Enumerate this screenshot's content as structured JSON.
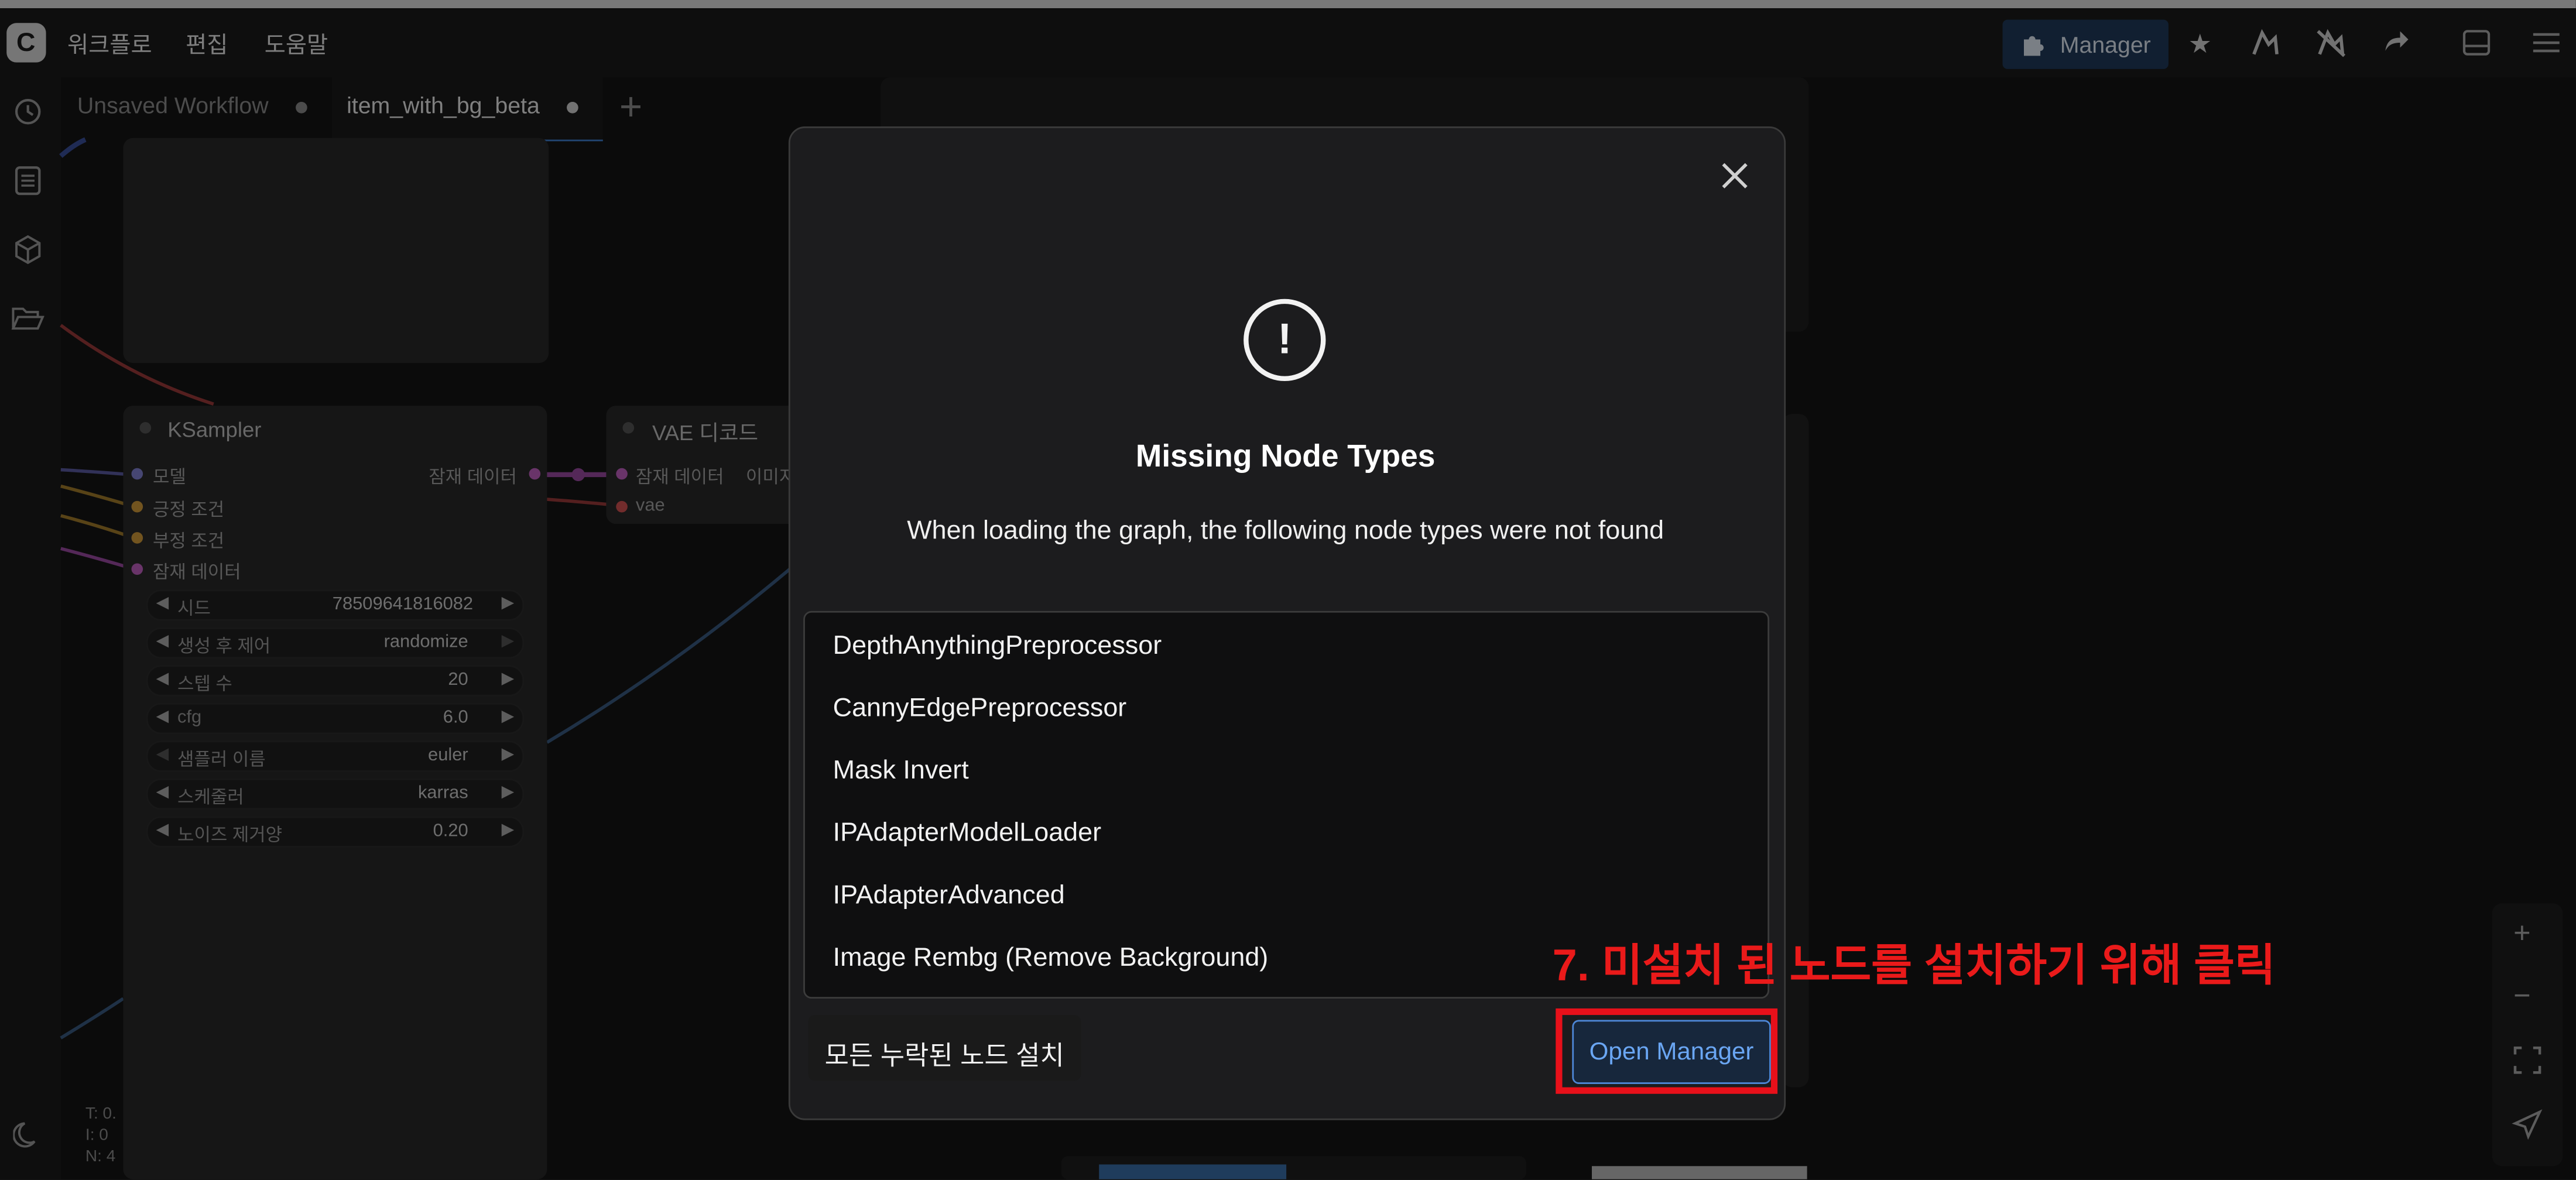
{
  "menubar": {
    "logo_letter": "C",
    "items": [
      "워크플로",
      "편집",
      "도움말"
    ]
  },
  "toolbar": {
    "manager_label": "Manager",
    "icons": [
      "puzzle-icon",
      "star-icon",
      "brush-icon",
      "brush-off-icon",
      "share-icon",
      "panel-icon",
      "hamburger-icon"
    ]
  },
  "tabs": [
    {
      "label": "Unsaved Workflow",
      "active": false
    },
    {
      "label": "item_with_bg_beta",
      "active": true
    }
  ],
  "ksampler": {
    "title": "KSampler",
    "inputs": [
      "모델",
      "긍정 조건",
      "부정 조건",
      "잠재 데이터"
    ],
    "output": "잠재 데이터",
    "widgets": [
      {
        "label": "시드",
        "value": "78509641816082"
      },
      {
        "label": "생성 후 제어",
        "value": "randomize"
      },
      {
        "label": "스텝 수",
        "value": "20"
      },
      {
        "label": "cfg",
        "value": "6.0"
      },
      {
        "label": "샘플러 이름",
        "value": "euler"
      },
      {
        "label": "스케줄러",
        "value": "karras"
      },
      {
        "label": "노이즈 제거양",
        "value": "0.20"
      }
    ]
  },
  "vae_node": {
    "title": "VAE 디코드",
    "inputs": [
      "잠재 데이터",
      "vae"
    ],
    "output": "이미지"
  },
  "stats": [
    "T: 0.",
    "I: 0",
    "N: 4"
  ],
  "dialog": {
    "title": "Missing Node Types",
    "message": "When loading the graph, the following node types were not found",
    "missing_nodes": [
      "DepthAnythingPreprocessor",
      "CannyEdgePreprocessor",
      "Mask Invert",
      "IPAdapterModelLoader",
      "IPAdapterAdvanced",
      "Image Rembg (Remove Background)"
    ],
    "install_all_label": "모든 누락된 노드 설치",
    "open_manager_label": "Open Manager",
    "close_icon": "×"
  },
  "annotation": "7. 미설치 된 노드를 설치하기 위해 클릭",
  "colors": {
    "accent": "#4d86d6",
    "annotation": "#ea1a1a",
    "background": "#141414"
  }
}
